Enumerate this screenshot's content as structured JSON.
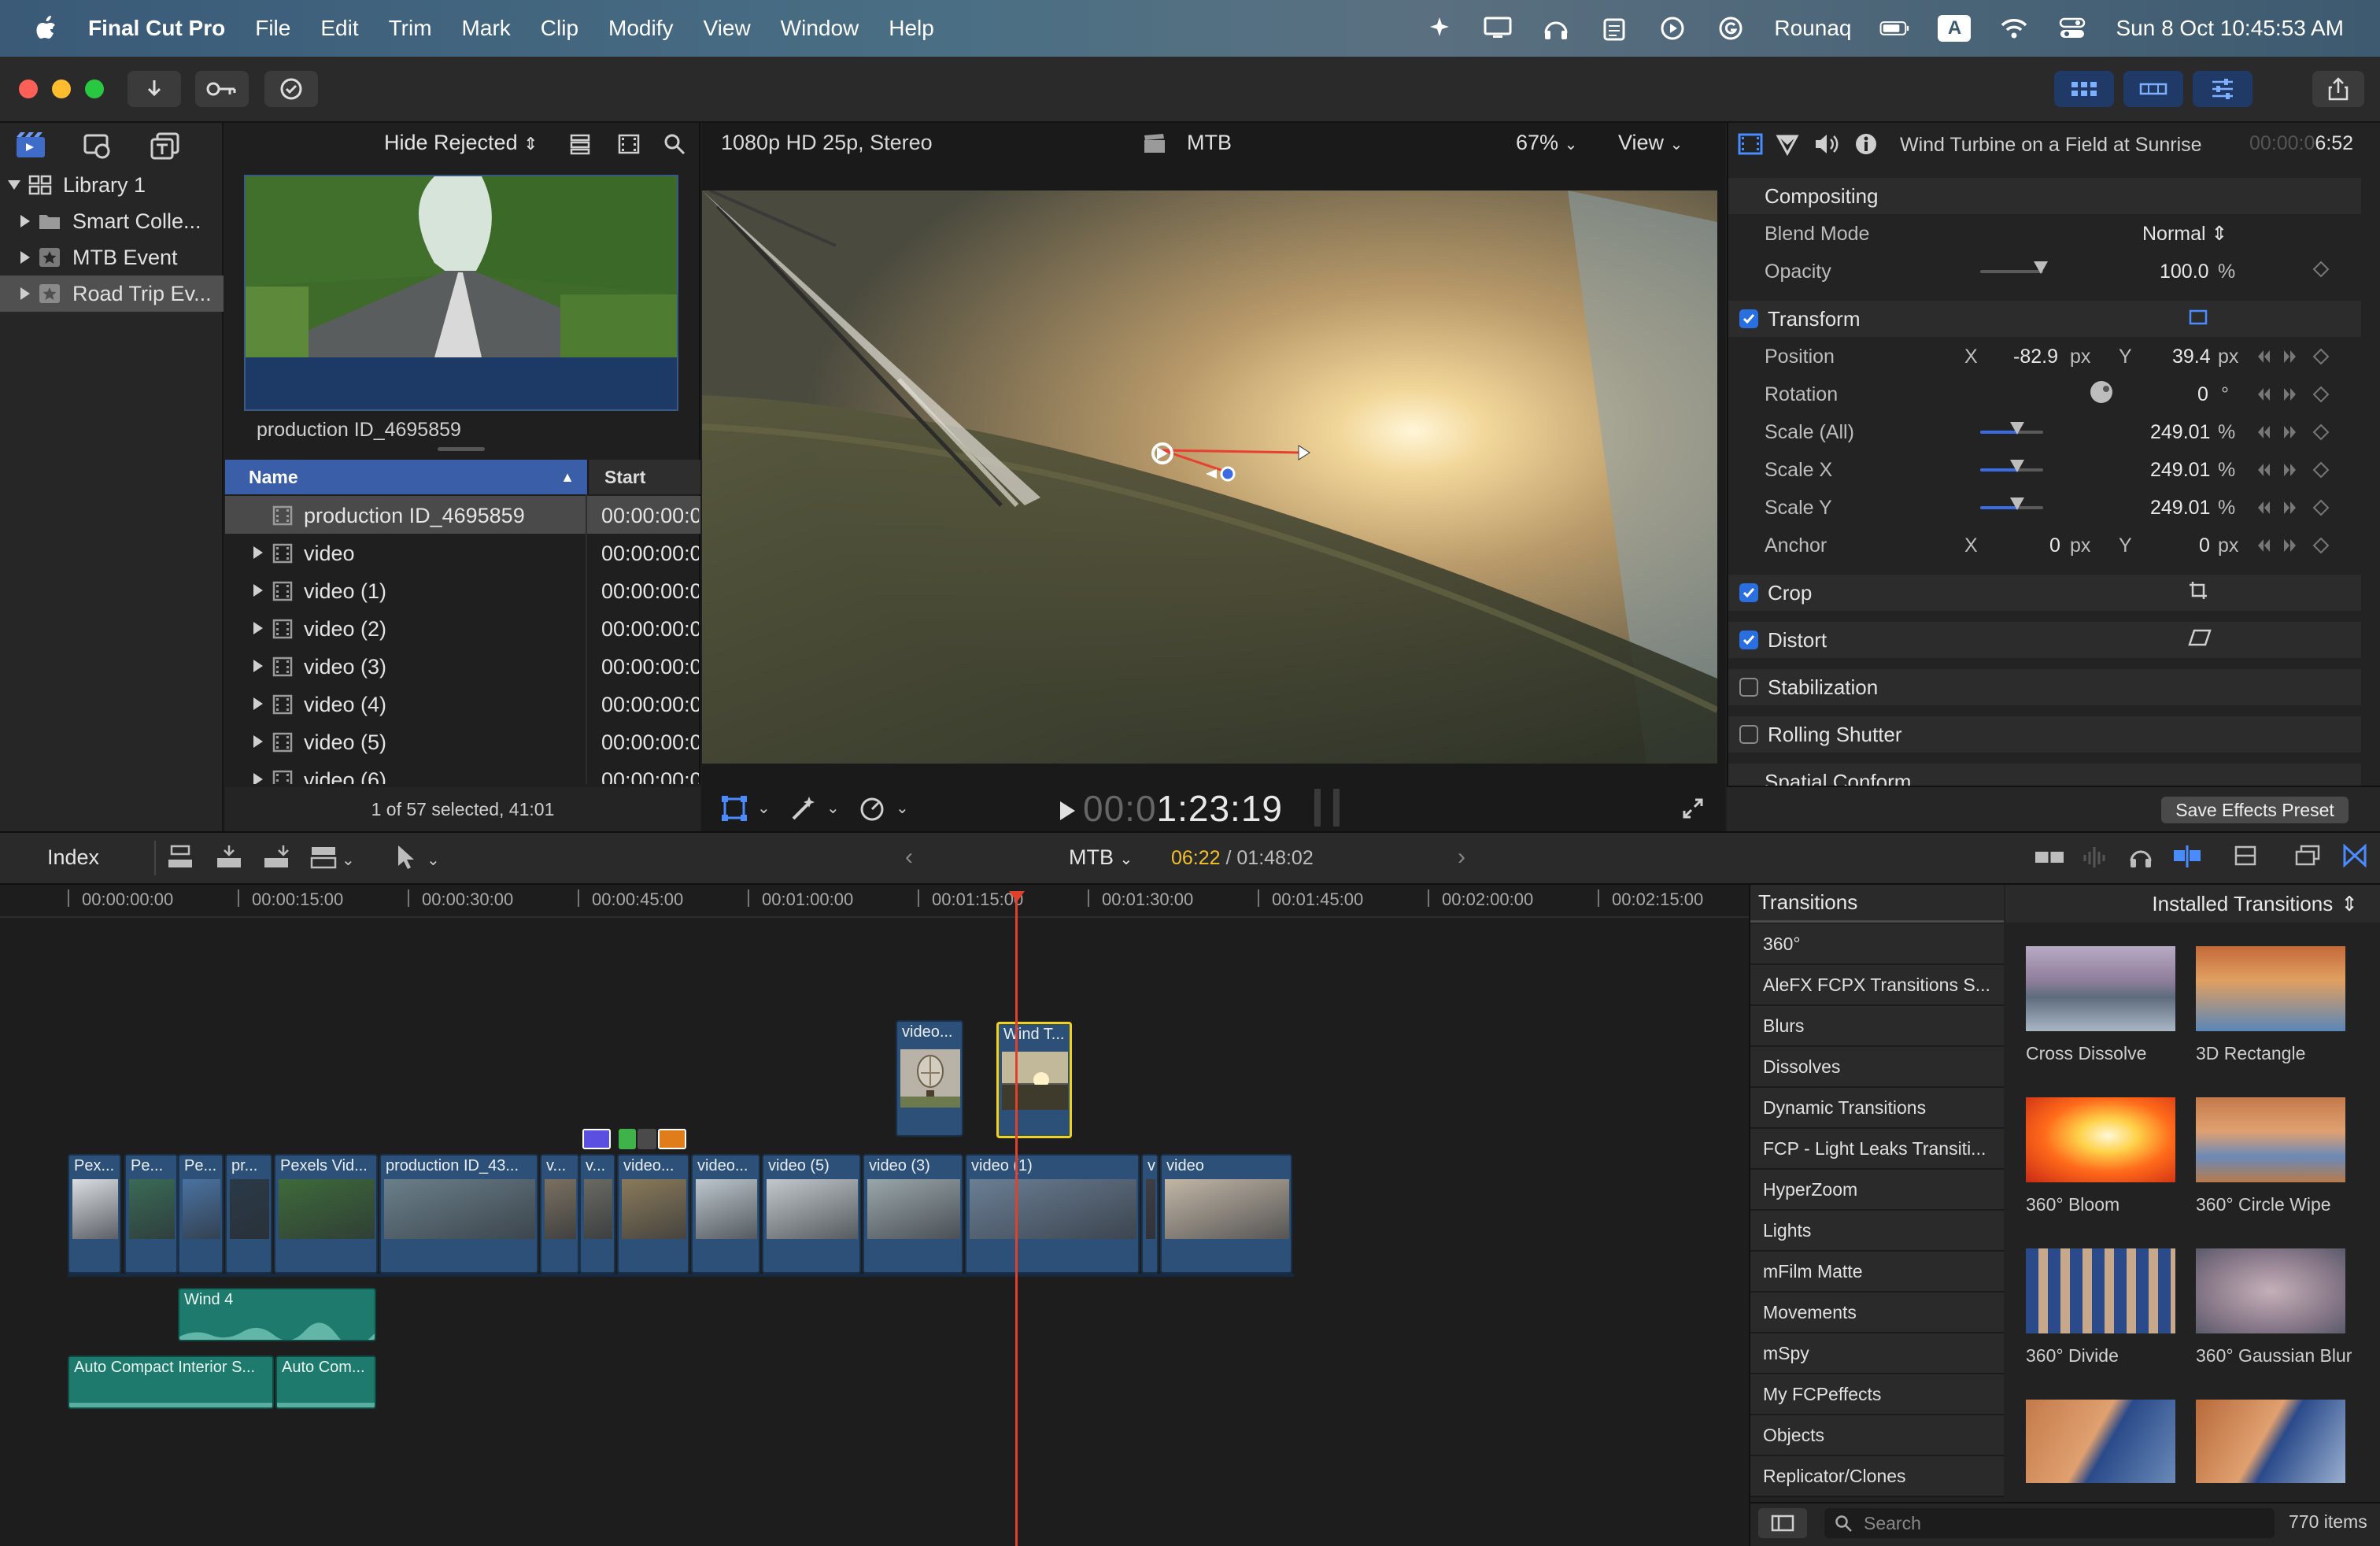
{
  "menubar": {
    "app_name": "Final Cut Pro",
    "items": [
      "File",
      "Edit",
      "Trim",
      "Mark",
      "Clip",
      "Modify",
      "View",
      "Window",
      "Help"
    ],
    "user": "Rounaq",
    "input_badge": "A",
    "datetime": "Sun 8 Oct  10:45:53 AM"
  },
  "browser": {
    "filter_label": "Hide Rejected",
    "sidebar": [
      {
        "label": "Library 1",
        "expanded": true
      },
      {
        "label": "Smart Colle..."
      },
      {
        "label": "MTB Event"
      },
      {
        "label": "Road Trip Ev...",
        "selected": true
      }
    ],
    "preview_label": "production ID_4695859",
    "columns": [
      "Name",
      "Start"
    ],
    "rows": [
      {
        "name": "production ID_4695859",
        "start": "00:00:00:0",
        "selected": true,
        "has_children": false
      },
      {
        "name": "video",
        "start": "00:00:00:0",
        "has_children": true
      },
      {
        "name": "video (1)",
        "start": "00:00:00:0",
        "has_children": true
      },
      {
        "name": "video (2)",
        "start": "00:00:00:0",
        "has_children": true
      },
      {
        "name": "video (3)",
        "start": "00:00:00:0",
        "has_children": true
      },
      {
        "name": "video (4)",
        "start": "00:00:00:0",
        "has_children": true
      },
      {
        "name": "video (5)",
        "start": "00:00:00:0",
        "has_children": true
      },
      {
        "name": "video (6)",
        "start": "00:00:00:0",
        "has_children": true
      }
    ],
    "selection_status": "1 of 57 selected, 41:01"
  },
  "viewer": {
    "format": "1080p HD 25p, Stereo",
    "project": "MTB",
    "zoom": "67%",
    "view_label": "View",
    "timecode_dim": "00:0",
    "timecode": "1:23:19"
  },
  "inspector": {
    "clip_title": "Wind Turbine on a Field at Sunrise",
    "duration_dim": "00:00:0",
    "duration": "6:52",
    "compositing": {
      "header": "Compositing",
      "blend_mode_label": "Blend Mode",
      "blend_mode": "Normal",
      "opacity_label": "Opacity",
      "opacity": "100.0",
      "opacity_unit": "%"
    },
    "transform": {
      "header": "Transform",
      "position_label": "Position",
      "x_label": "X",
      "y_label": "Y",
      "pos_x": "-82.9",
      "pos_y": "39.4",
      "px": "px",
      "rotation_label": "Rotation",
      "rotation": "0",
      "deg": "°",
      "scale_all_label": "Scale (All)",
      "scale_all": "249.01",
      "scale_x_label": "Scale X",
      "scale_x": "249.01",
      "scale_y_label": "Scale Y",
      "scale_y": "249.01",
      "pct": "%",
      "anchor_label": "Anchor",
      "anchor_x": "0",
      "anchor_y": "0"
    },
    "sections": [
      {
        "label": "Crop",
        "checked": true
      },
      {
        "label": "Distort",
        "checked": true
      },
      {
        "label": "Stabilization",
        "checked": false
      },
      {
        "label": "Rolling Shutter",
        "checked": false
      },
      {
        "label": "Spatial Conform",
        "checked": false
      }
    ],
    "save_preset": "Save Effects Preset"
  },
  "timeline": {
    "index_label": "Index",
    "project": "MTB",
    "position": "06:22",
    "total": "/ 01:48:02",
    "ruler": [
      "00:00:00:00",
      "00:00:15:00",
      "00:00:30:00",
      "00:00:45:00",
      "00:01:00:00",
      "00:01:15:00",
      "00:01:30:00",
      "00:01:45:00",
      "00:02:00:00",
      "00:02:15:00"
    ],
    "primary_clips": [
      {
        "label": "Pex..."
      },
      {
        "label": "Pe..."
      },
      {
        "label": "Pe..."
      },
      {
        "label": "pr..."
      },
      {
        "label": "Pexels Vid..."
      },
      {
        "label": "production ID_43..."
      },
      {
        "label": "v..."
      },
      {
        "label": "v..."
      },
      {
        "label": "video..."
      },
      {
        "label": "video..."
      },
      {
        "label": "video (5)"
      },
      {
        "label": "video (3)"
      },
      {
        "label": "video (1)"
      },
      {
        "label": "v"
      },
      {
        "label": "video"
      }
    ],
    "connected_clips": [
      {
        "label": "video..."
      },
      {
        "label": "Wind T..."
      }
    ],
    "audio_clips": [
      {
        "label": "Wind 4"
      },
      {
        "label": "Auto Compact Interior S..."
      },
      {
        "label": "Auto Com..."
      }
    ]
  },
  "transitions": {
    "header": "Transitions",
    "selector": "Installed Transitions",
    "categories": [
      "360°",
      "AleFX FCPX Transitions S...",
      "Blurs",
      "Dissolves",
      "Dynamic Transitions",
      "FCP - Light Leaks Transiti...",
      "HyperZoom",
      "Lights",
      "mFilm Matte",
      "Movements",
      "mSpy",
      "My FCPeffects",
      "Objects",
      "Replicator/Clones"
    ],
    "items": [
      {
        "label": "Cross Dissolve"
      },
      {
        "label": "3D Rectangle"
      },
      {
        "label": "360° Bloom"
      },
      {
        "label": "360° Circle Wipe"
      },
      {
        "label": "360° Divide"
      },
      {
        "label": "360° Gaussian Blur"
      }
    ],
    "search_placeholder": "Search",
    "count": "770 items"
  },
  "colors": {
    "accent": "#2a6fe0",
    "selection_yellow": "#f2d11a",
    "playhead": "#e0402c",
    "video_clip": "#2d5078",
    "audio_clip": "#1f7a6e"
  }
}
